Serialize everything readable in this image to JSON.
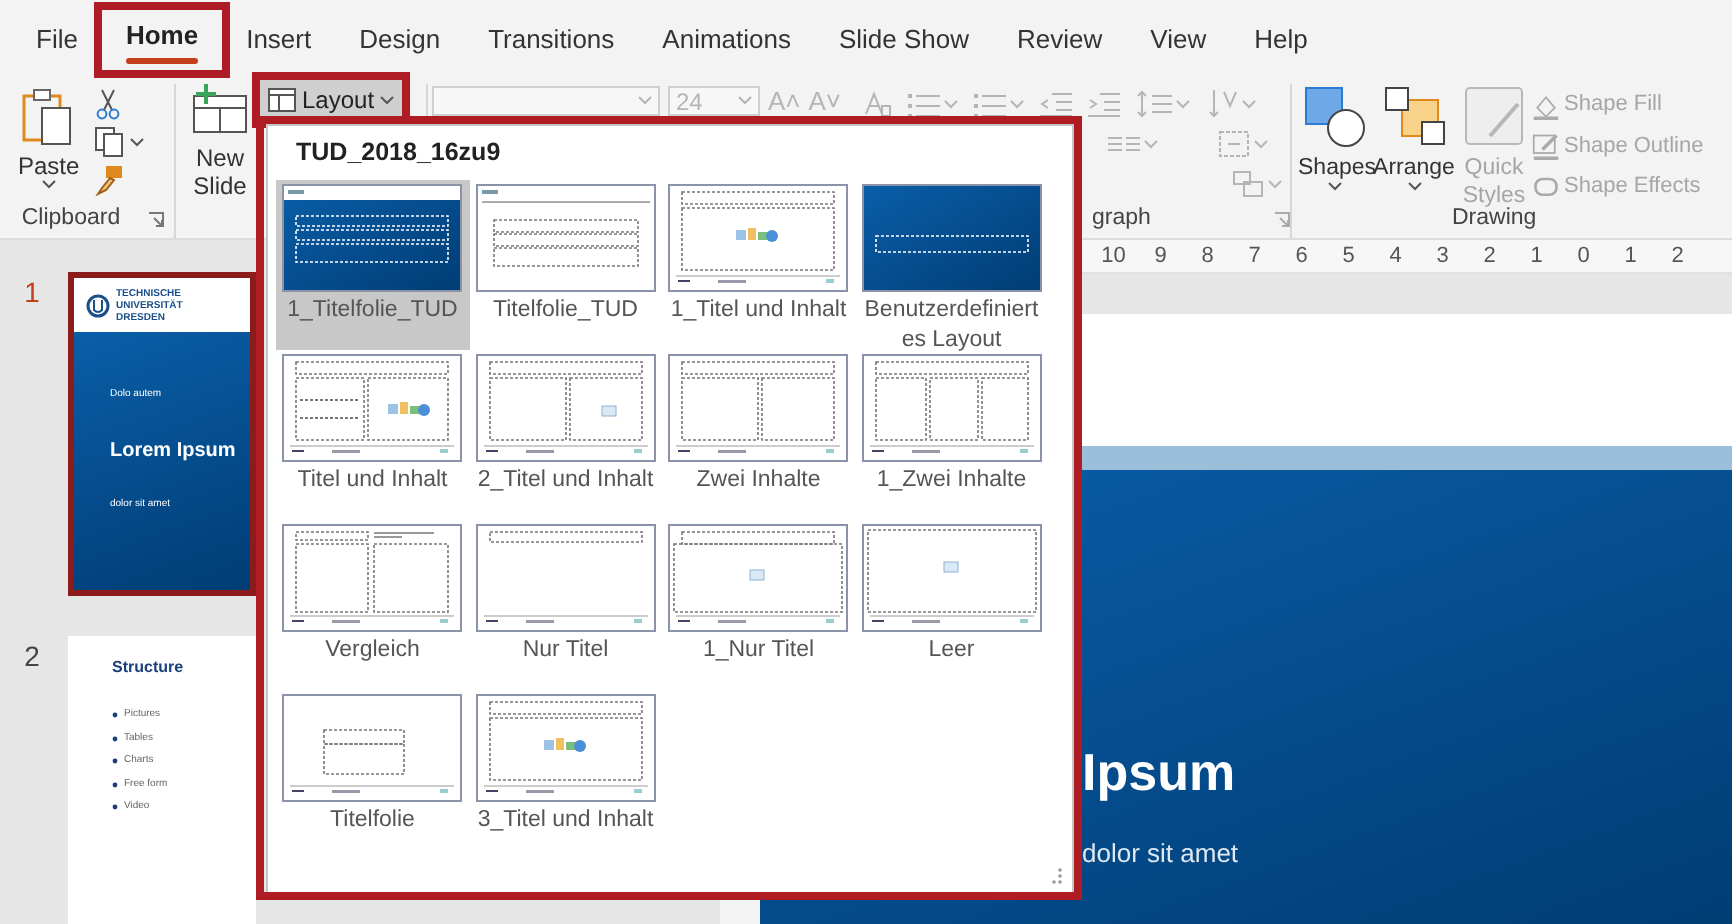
{
  "menu_tabs": [
    {
      "label": "File",
      "selected": false,
      "highlighted": false
    },
    {
      "label": "Home",
      "selected": true,
      "highlighted": true
    },
    {
      "label": "Insert",
      "selected": false,
      "highlighted": false
    },
    {
      "label": "Design",
      "selected": false,
      "highlighted": false
    },
    {
      "label": "Transitions",
      "selected": false,
      "highlighted": false
    },
    {
      "label": "Animations",
      "selected": false,
      "highlighted": false
    },
    {
      "label": "Slide Show",
      "selected": false,
      "highlighted": false
    },
    {
      "label": "Review",
      "selected": false,
      "highlighted": false
    },
    {
      "label": "View",
      "selected": false,
      "highlighted": false
    },
    {
      "label": "Help",
      "selected": false,
      "highlighted": false
    }
  ],
  "clipboard": {
    "paste_label": "Paste",
    "group_label": "Clipboard"
  },
  "slides_group": {
    "new_slide_label": "New Slide",
    "layout_button": {
      "label": "Layout",
      "pressed": true,
      "highlighted": true
    }
  },
  "font_group": {
    "disabled": true,
    "font_size": "24",
    "size_buttons": [
      "A˄",
      "A˅"
    ]
  },
  "paragraph_group": {
    "disabled": true,
    "group_label": "graph"
  },
  "drawing_group": {
    "large_buttons": [
      {
        "label": "Shapes",
        "kind": "shapes",
        "disabled": false
      },
      {
        "label": "Arrange",
        "kind": "arrange",
        "disabled": false
      },
      {
        "label": "Quick Styles",
        "kind": "quick-styles",
        "disabled": true
      }
    ],
    "commands": [
      {
        "label": "Shape Fill",
        "kind": "fill",
        "disabled": true
      },
      {
        "label": "Shape Outline",
        "kind": "outline",
        "disabled": true
      },
      {
        "label": "Shape Effects",
        "kind": "effects",
        "disabled": true
      }
    ],
    "group_label": "Drawing"
  },
  "ruler": {
    "ticks": [
      "10",
      "9",
      "8",
      "7",
      "6",
      "5",
      "4",
      "3",
      "2",
      "1",
      "0",
      "1",
      "2"
    ]
  },
  "slide_pane": {
    "slides": [
      {
        "number": "1",
        "kind": "title",
        "selected": true,
        "logo_text": "TECHNISCHE UNIVERSITÄT DRESDEN",
        "kicker": "Dolo autem",
        "title": "Lorem Ipsum",
        "subtitle": "dolor sit amet"
      },
      {
        "number": "2",
        "kind": "content",
        "selected": false,
        "title": "Structure",
        "bullets": [
          "Pictures",
          "Tables",
          "Charts",
          "Free form",
          "Video"
        ]
      }
    ]
  },
  "main_slide": {
    "title": "Ipsum",
    "subtitle": "dolor sit amet"
  },
  "layout_gallery": {
    "highlighted": true,
    "heading": "TUD_2018_16zu9",
    "layouts": [
      {
        "name": "1_Titelfolie_TUD",
        "kind": "title-blue",
        "selected": true
      },
      {
        "name": "Titelfolie_TUD",
        "kind": "title-white",
        "selected": false
      },
      {
        "name": "1_Titel und Inhalt",
        "kind": "content",
        "selected": false
      },
      {
        "name": "Benutzerdefiniertes Layout",
        "kind": "custom-blue",
        "selected": false
      },
      {
        "name": "Titel und Inhalt",
        "kind": "left-content",
        "selected": false
      },
      {
        "name": "2_Titel und Inhalt",
        "kind": "two-picture",
        "selected": false
      },
      {
        "name": "Zwei Inhalte",
        "kind": "two",
        "selected": false
      },
      {
        "name": "1_Zwei Inhalte",
        "kind": "three",
        "selected": false
      },
      {
        "name": "Vergleich",
        "kind": "compare",
        "selected": false
      },
      {
        "name": "Nur Titel",
        "kind": "title-only",
        "selected": false
      },
      {
        "name": "1_Nur Titel",
        "kind": "title-picture",
        "selected": false
      },
      {
        "name": "Leer",
        "kind": "blank-picture",
        "selected": false
      },
      {
        "name": "Titelfolie",
        "kind": "title-small",
        "selected": false
      },
      {
        "name": "3_Titel und Inhalt",
        "kind": "content",
        "selected": false
      }
    ]
  }
}
